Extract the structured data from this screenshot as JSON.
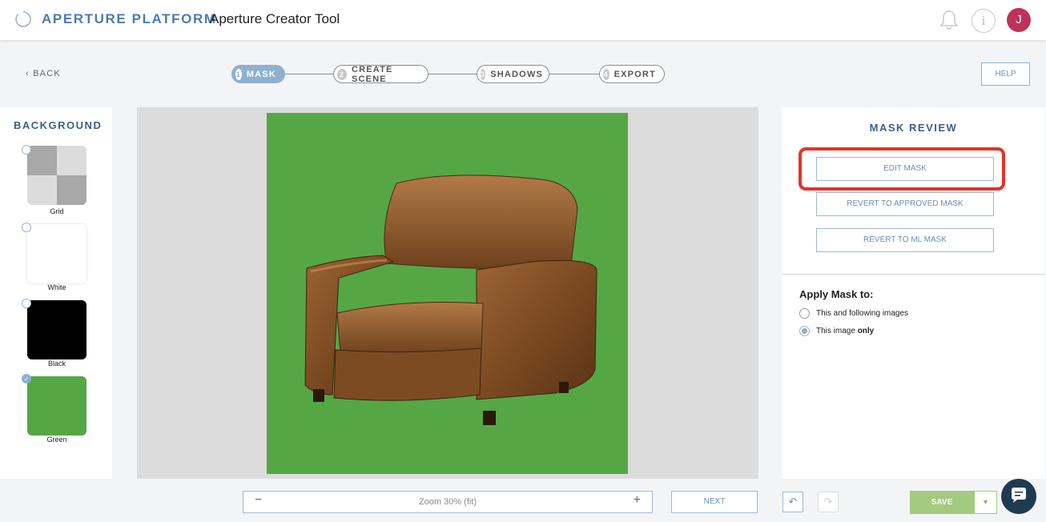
{
  "header": {
    "brand": "APERTURE PLATFORM",
    "app_name": "Aperture Creator Tool",
    "avatar_initial": "J",
    "info_glyph": "i",
    "icons": [
      "loading-circle-icon",
      "bell-icon",
      "info-icon"
    ]
  },
  "nav": {
    "back_label": "BACK",
    "help_label": "HELP",
    "steps": [
      {
        "num": "1",
        "label": "MASK",
        "active": true
      },
      {
        "num": "2",
        "label": "CREATE SCENE",
        "active": false
      },
      {
        "num": "3",
        "label": "SHADOWS",
        "active": false
      },
      {
        "num": "4",
        "label": "EXPORT",
        "active": false
      }
    ]
  },
  "background_panel": {
    "title": "BACKGROUND",
    "options": [
      {
        "label": "Grid",
        "selected": false
      },
      {
        "label": "White",
        "selected": false
      },
      {
        "label": "Black",
        "selected": false
      },
      {
        "label": "Green",
        "selected": true
      }
    ]
  },
  "canvas": {
    "background_color": "#55a745",
    "subject": "leather-armchair-image"
  },
  "mask_review": {
    "title": "MASK REVIEW",
    "edit_mask_label": "EDIT MASK",
    "revert_approved_label": "REVERT TO APPROVED MASK",
    "revert_ml_label": "REVERT TO ML MASK",
    "apply_title": "Apply Mask to:",
    "apply_options": [
      {
        "label": "This and following images",
        "selected": false
      },
      {
        "label_prefix": "This image ",
        "label_bold": "only",
        "selected": true
      }
    ]
  },
  "footer": {
    "zoom_minus": "−",
    "zoom_text": "Zoom 30% (fit)",
    "zoom_plus": "+",
    "next_label": "NEXT",
    "save_label": "SAVE"
  },
  "colors": {
    "accent": "#8fb0cf",
    "brand": "#4a7bb0",
    "highlight": "#e53228",
    "save": "#a3ca80",
    "avatar": "#c0315a"
  }
}
